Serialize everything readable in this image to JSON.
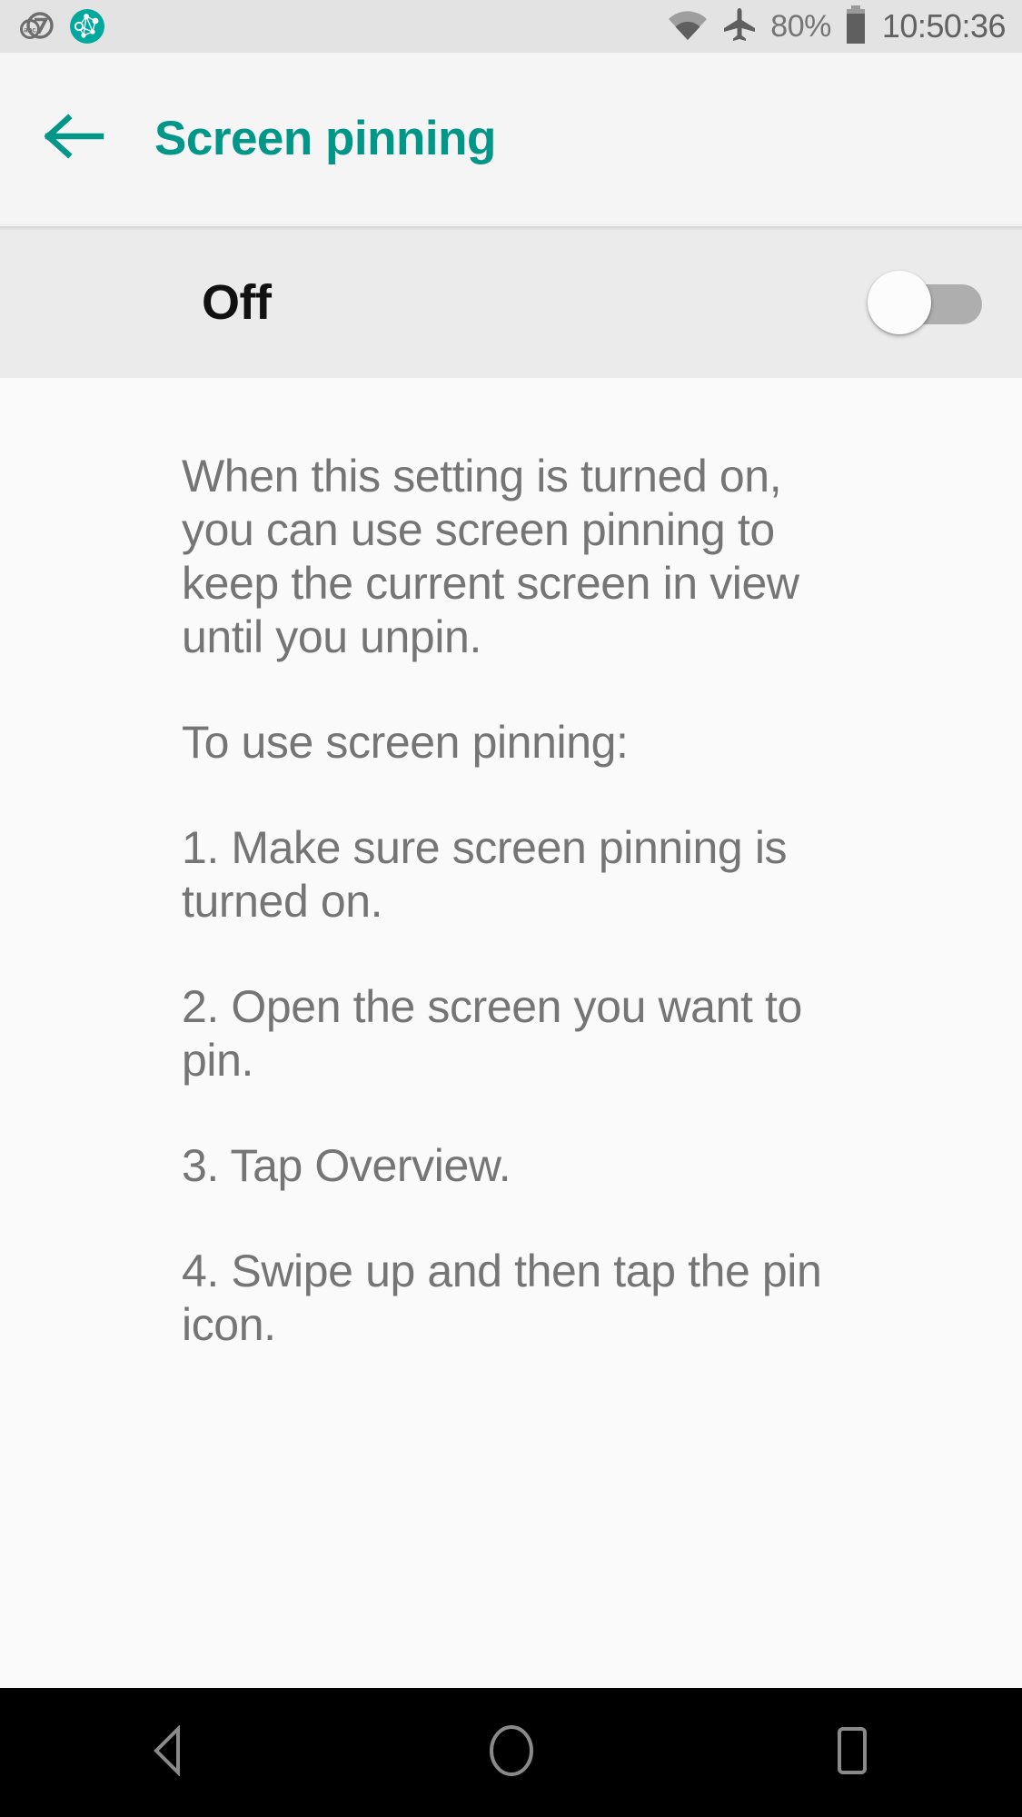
{
  "status_bar": {
    "notifications": [
      {
        "name": "abc7-news-icon",
        "label": "abc7"
      },
      {
        "name": "network-graph-icon",
        "label": "network"
      }
    ],
    "wifi_icon": "wifi-icon",
    "airplane_icon": "airplane-mode-icon",
    "battery_percent": "80%",
    "battery_icon": "battery-icon",
    "time": "10:50:36"
  },
  "app_bar": {
    "back_icon": "arrow-back-icon",
    "title": "Screen pinning",
    "accent_color": "#009688"
  },
  "toggle_row": {
    "label": "Off",
    "state": "off"
  },
  "content": {
    "paragraphs": [
      "When this setting is turned on, you can use screen pinning to keep the current screen in view until you unpin.",
      "To use screen pinning:",
      "1. Make sure screen pinning is turned on.",
      "2. Open the screen you want to pin.",
      "3. Tap Overview.",
      "4. Swipe up and then tap the pin icon."
    ]
  },
  "nav_bar": {
    "back_label": "Back",
    "home_label": "Home",
    "recents_label": "Overview"
  }
}
